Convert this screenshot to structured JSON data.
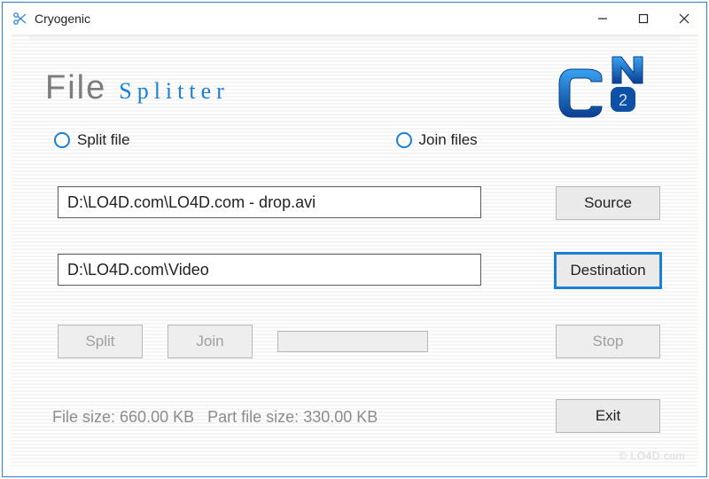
{
  "titlebar": {
    "title": "Cryogenic"
  },
  "heading": {
    "word1": "File",
    "word2": "Splitter"
  },
  "radios": {
    "split": "Split file",
    "join": "Join files"
  },
  "fields": {
    "source_value": "D:\\LO4D.com\\LO4D.com - drop.avi",
    "dest_value": "D:\\LO4D.com\\Video"
  },
  "buttons": {
    "source": "Source",
    "destination": "Destination",
    "split": "Split",
    "join": "Join",
    "stop": "Stop",
    "exit": "Exit"
  },
  "status": {
    "file_size_label": "File size:",
    "file_size_value": "660.00 KB",
    "part_size_label": "Part file size:",
    "part_size_value": "330.00 KB"
  },
  "watermark": "© LO4D.com"
}
